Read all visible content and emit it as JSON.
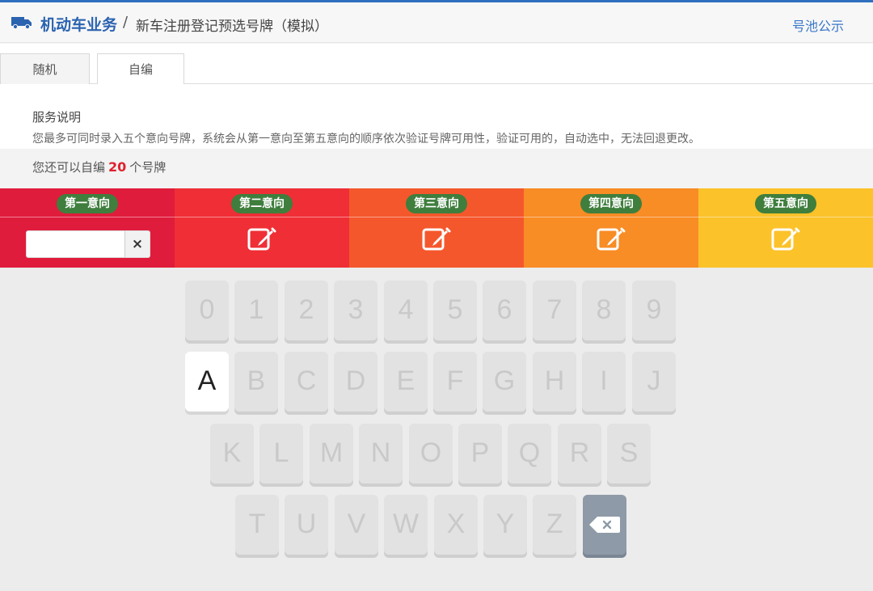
{
  "header": {
    "brand": "机动车业务",
    "separator": "/",
    "subtitle": "新车注册登记预选号牌（模拟）",
    "pool_link": "号池公示",
    "brand_icon": "truck-icon",
    "accent": "#2b63b0"
  },
  "tabs": [
    {
      "label": "随机",
      "active": false
    },
    {
      "label": "自编",
      "active": true
    }
  ],
  "service": {
    "title": "服务说明",
    "text": "您最多可同时录入五个意向号牌，系统会从第一意向至第五意向的顺序依次验证号牌可用性，验证可用的，自动选中，无法回退更改。"
  },
  "remaining": {
    "prefix": "您还可以自编",
    "count": "20",
    "suffix": "个号牌"
  },
  "choices": [
    {
      "label": "第一意向",
      "color": "#e01c3c",
      "state": "input",
      "value": ""
    },
    {
      "label": "第二意向",
      "color": "#ef2e36",
      "state": "edit"
    },
    {
      "label": "第三意向",
      "color": "#f5572c",
      "state": "edit"
    },
    {
      "label": "第四意向",
      "color": "#f88c25",
      "state": "edit"
    },
    {
      "label": "第五意向",
      "color": "#fbc22a",
      "state": "edit"
    }
  ],
  "clear_symbol": "×",
  "keyboard": {
    "rows": [
      [
        "0",
        "1",
        "2",
        "3",
        "4",
        "5",
        "6",
        "7",
        "8",
        "9"
      ],
      [
        "A",
        "B",
        "C",
        "D",
        "E",
        "F",
        "G",
        "H",
        "I",
        "J"
      ],
      [
        "K",
        "L",
        "M",
        "N",
        "O",
        "P",
        "Q",
        "R",
        "S"
      ],
      [
        "T",
        "U",
        "V",
        "W",
        "X",
        "Y",
        "Z"
      ]
    ],
    "active_key": "A",
    "backspace_icon": "backspace-icon"
  }
}
